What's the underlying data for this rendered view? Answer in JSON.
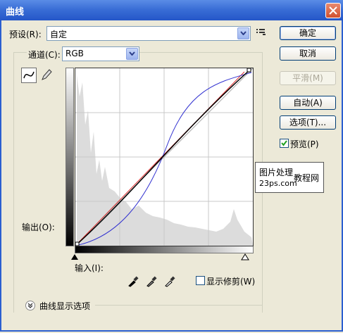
{
  "window": {
    "title": "曲线"
  },
  "preset": {
    "label": "预设(R):",
    "value": "自定"
  },
  "channel": {
    "label": "通道(C):",
    "value": "RGB"
  },
  "buttons": {
    "ok": "确定",
    "cancel": "取消",
    "smooth": "平滑(M)",
    "auto": "自动(A)",
    "options": "选项(T)..."
  },
  "preview": {
    "label": "预览(P)",
    "checked": true
  },
  "output_label": "输出(O):",
  "input_label": "输入(I):",
  "show_clipping": {
    "label": "显示修剪(W)",
    "checked": false
  },
  "display_options": {
    "label": "曲线显示选项"
  },
  "watermark": {
    "line1": "图片处理",
    "line2": "教程网",
    "line3": "23ps.com"
  },
  "icons": [
    "close-icon",
    "menu-icon",
    "curve-tool-icon",
    "pencil-icon",
    "black-eyedropper-icon",
    "gray-eyedropper-icon",
    "white-eyedropper-icon",
    "expand-icon"
  ]
}
